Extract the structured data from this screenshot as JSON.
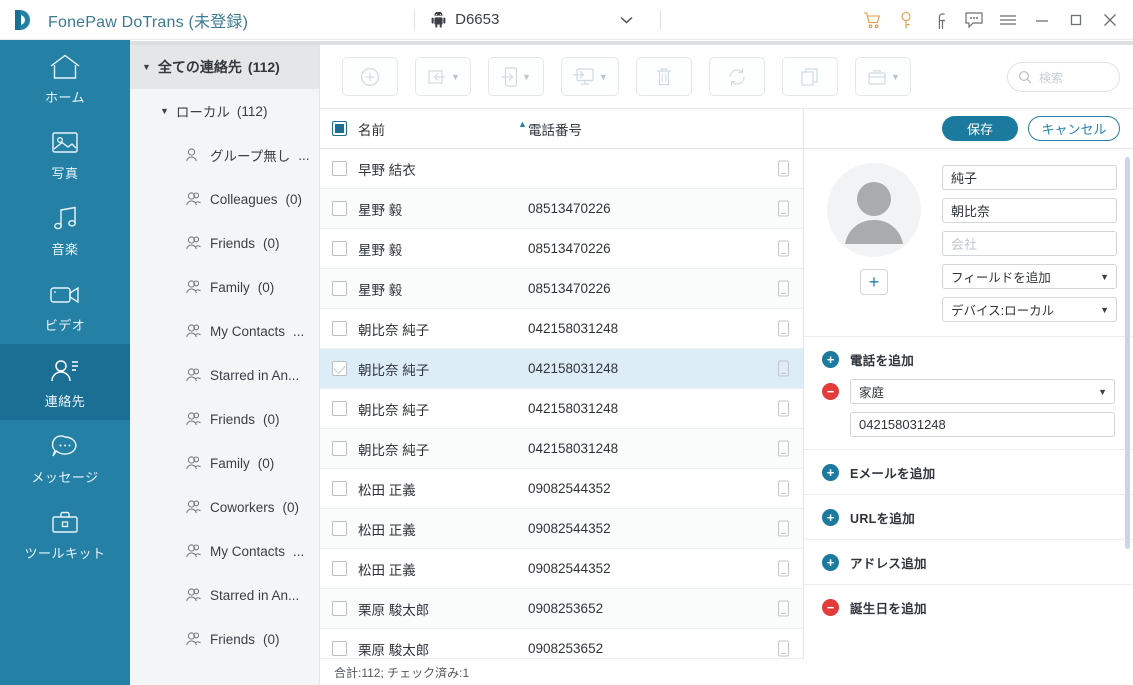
{
  "titlebar": {
    "app_title": "FonePaw DoTrans (未登録)",
    "device_name": "D6653",
    "icons": [
      "cart-icon",
      "key-icon",
      "facebook-icon",
      "feedback-icon",
      "menu-icon",
      "minimize-icon",
      "maximize-icon",
      "close-icon"
    ]
  },
  "rail": {
    "items": [
      {
        "label": "ホーム",
        "icon": "home-icon",
        "active": false
      },
      {
        "label": "写真",
        "icon": "photo-icon",
        "active": false
      },
      {
        "label": "音楽",
        "icon": "music-icon",
        "active": false
      },
      {
        "label": "ビデオ",
        "icon": "video-icon",
        "active": false
      },
      {
        "label": "連絡先",
        "icon": "contacts-icon",
        "active": true
      },
      {
        "label": "メッセージ",
        "icon": "message-icon",
        "active": false
      },
      {
        "label": "ツールキット",
        "icon": "toolkit-icon",
        "active": false
      }
    ]
  },
  "tree": {
    "root": {
      "label": "全ての連絡先",
      "count": "(112)"
    },
    "local": {
      "label": "ローカル",
      "count": "(112)"
    },
    "groups": [
      {
        "label": "グループ無し",
        "count": "..."
      },
      {
        "label": "Colleagues",
        "count": "(0)"
      },
      {
        "label": "Friends",
        "count": "(0)"
      },
      {
        "label": "Family",
        "count": "(0)"
      },
      {
        "label": "My Contacts",
        "count": "..."
      },
      {
        "label": "Starred in An...",
        "count": ""
      },
      {
        "label": "Friends",
        "count": "(0)"
      },
      {
        "label": "Family",
        "count": "(0)"
      },
      {
        "label": "Coworkers",
        "count": "(0)"
      },
      {
        "label": "My Contacts",
        "count": "..."
      },
      {
        "label": "Starred in An...",
        "count": ""
      },
      {
        "label": "Friends",
        "count": "(0)"
      }
    ]
  },
  "toolbar": {
    "buttons": [
      {
        "name": "add-contact-button",
        "icon": "plus-circle-icon",
        "caret": false
      },
      {
        "name": "import-button",
        "icon": "import-icon",
        "caret": true
      },
      {
        "name": "export-to-device-button",
        "icon": "export-phone-icon",
        "caret": true
      },
      {
        "name": "export-to-pc-button",
        "icon": "export-pc-icon",
        "caret": true
      },
      {
        "name": "delete-button",
        "icon": "trash-icon",
        "caret": false
      },
      {
        "name": "refresh-button",
        "icon": "refresh-icon",
        "caret": false
      },
      {
        "name": "duplicate-button",
        "icon": "copy-icon",
        "caret": false
      },
      {
        "name": "merge-button",
        "icon": "toolbox-icon",
        "caret": true
      }
    ],
    "search_placeholder": "検索",
    "search_value": ""
  },
  "list": {
    "columns": {
      "name": "名前",
      "phone": "電話番号"
    },
    "sort": {
      "column": "名前",
      "direction": "asc"
    },
    "select_all_checked": true,
    "rows": [
      {
        "name": "早野 結衣",
        "phone": "",
        "checked": false,
        "selected": false
      },
      {
        "name": "星野 毅",
        "phone": "08513470226",
        "checked": false,
        "selected": false
      },
      {
        "name": "星野 毅",
        "phone": "08513470226",
        "checked": false,
        "selected": false
      },
      {
        "name": "星野 毅",
        "phone": "08513470226",
        "checked": false,
        "selected": false
      },
      {
        "name": "朝比奈 純子",
        "phone": "042158031248",
        "checked": false,
        "selected": false
      },
      {
        "name": "朝比奈 純子",
        "phone": "042158031248",
        "checked": true,
        "selected": true
      },
      {
        "name": "朝比奈 純子",
        "phone": "042158031248",
        "checked": false,
        "selected": false
      },
      {
        "name": "朝比奈 純子",
        "phone": "042158031248",
        "checked": false,
        "selected": false
      },
      {
        "name": "松田 正義",
        "phone": "09082544352",
        "checked": false,
        "selected": false
      },
      {
        "name": "松田 正義",
        "phone": "09082544352",
        "checked": false,
        "selected": false
      },
      {
        "name": "松田 正義",
        "phone": "09082544352",
        "checked": false,
        "selected": false
      },
      {
        "name": "栗原 駿太郎",
        "phone": "0908253652",
        "checked": false,
        "selected": false
      },
      {
        "name": "栗原 駿太郎",
        "phone": "0908253652",
        "checked": false,
        "selected": false
      }
    ],
    "status": "合計:112; チェック済み:1"
  },
  "detail": {
    "save_label": "保存",
    "cancel_label": "キャンセル",
    "avatar_add_label": "+",
    "first_name": "純子",
    "last_name": "朝比奈",
    "company_placeholder": "会社",
    "company_value": "",
    "add_field_label": "フィールドを追加",
    "device_label": "デバイス:ローカル",
    "sections": [
      {
        "name": "phone",
        "action": "add",
        "label": "電話を追加",
        "entry": {
          "action": "remove",
          "type": "家庭",
          "value": "042158031248"
        }
      },
      {
        "name": "email",
        "action": "add",
        "label": "Eメールを追加"
      },
      {
        "name": "url",
        "action": "add",
        "label": "URLを追加"
      },
      {
        "name": "address",
        "action": "add",
        "label": "アドレス追加"
      },
      {
        "name": "birthday",
        "action": "remove",
        "label": "誕生日を追加"
      }
    ]
  },
  "colors": {
    "brand": "#2580a6",
    "brand_dark": "#1b6e94",
    "accent_orange": "#e89a3c",
    "row_selected": "#dcedf7",
    "danger": "#e23b3b"
  }
}
